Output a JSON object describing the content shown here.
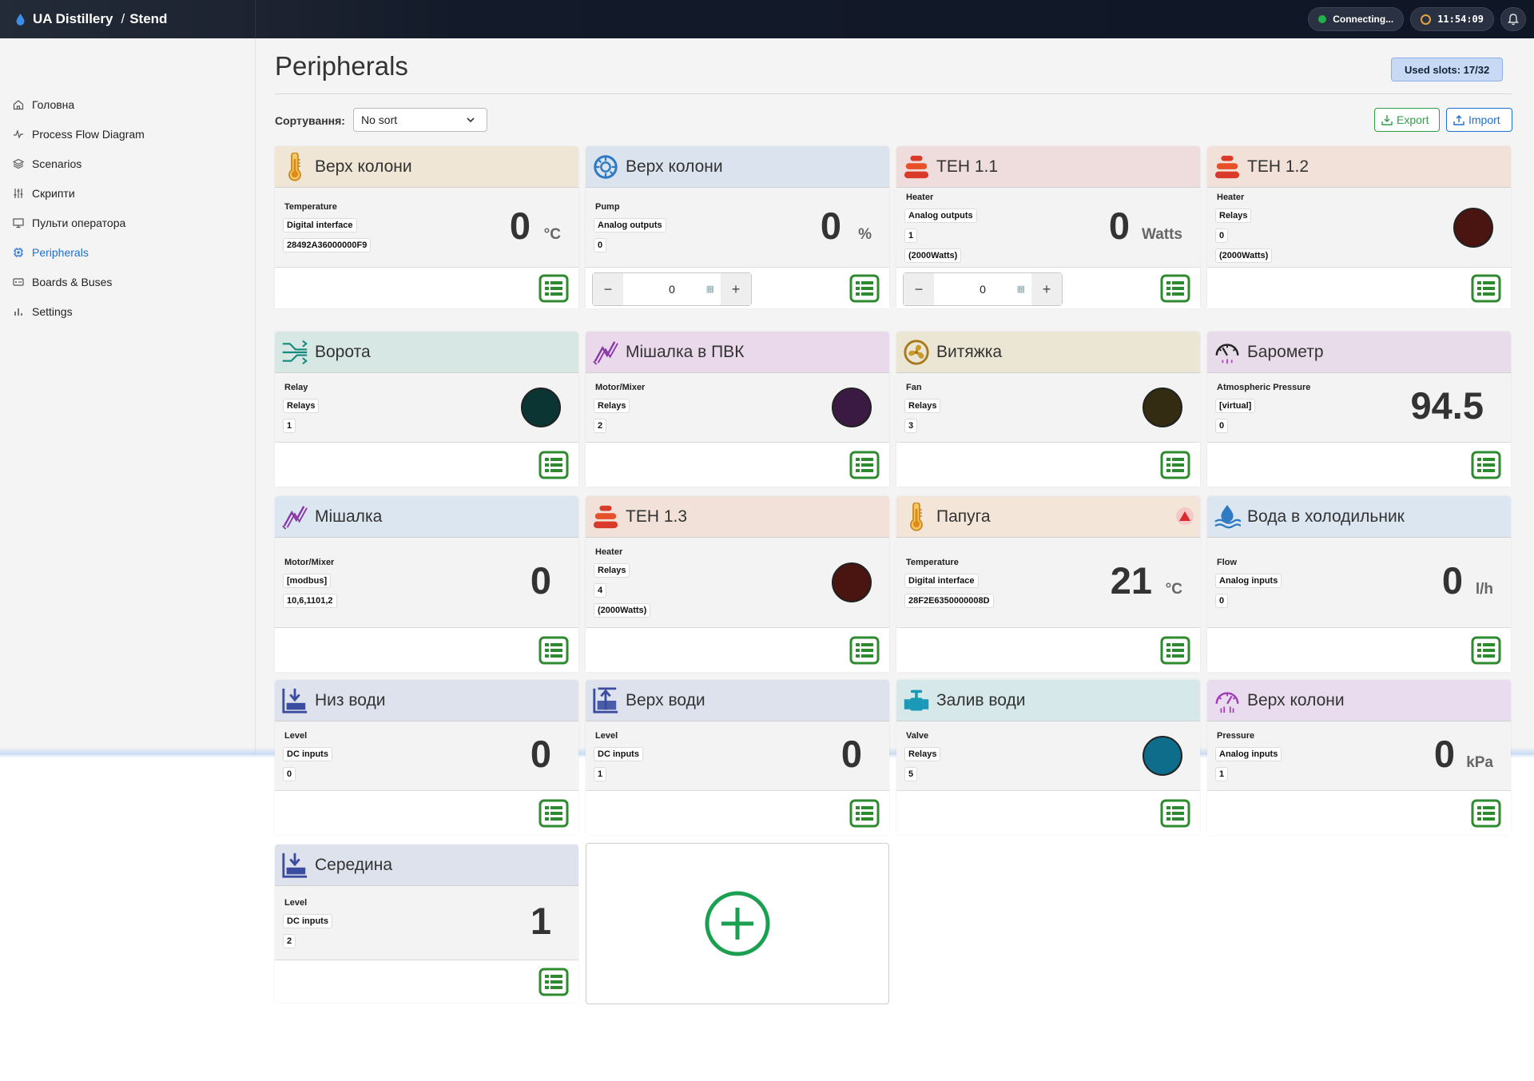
{
  "app": {
    "name": "UA Distillery",
    "separator": "/",
    "location": "Stend"
  },
  "topbar": {
    "status": "Connecting...",
    "time": "11:54:09",
    "status_color": "#22b04a"
  },
  "sidebar": {
    "items": [
      {
        "label": "Головна",
        "icon": "home-icon"
      },
      {
        "label": "Process Flow Diagram",
        "icon": "activity-icon"
      },
      {
        "label": "Scenarios",
        "icon": "layers-icon"
      },
      {
        "label": "Скрипти",
        "icon": "sliders-icon"
      },
      {
        "label": "Пульти оператора",
        "icon": "monitor-icon"
      },
      {
        "label": "Peripherals",
        "icon": "chip-icon",
        "active": true
      },
      {
        "label": "Boards & Buses",
        "icon": "drive-icon"
      },
      {
        "label": "Settings",
        "icon": "bar-chart-icon"
      }
    ]
  },
  "page": {
    "title": "Peripherals",
    "used_slots": "Used slots: 17/32",
    "sort_label": "Сортування:",
    "sort_value": "No sort",
    "export_label": "Export",
    "import_label": "Import"
  },
  "cards": [
    {
      "title": "Верх колони",
      "icon": "thermometer-icon",
      "head_color": "#efe6d6",
      "type": "Temperature",
      "chips": [
        "Digital interface",
        "28492A36000000F9"
      ],
      "value": "0",
      "unit": "°C"
    },
    {
      "title": "Верх колони",
      "icon": "pump-icon",
      "head_color": "#dbe4ee",
      "type": "Pump",
      "chips": [
        "Analog outputs",
        "0"
      ],
      "value": "0",
      "unit": "%",
      "stepper": "0"
    },
    {
      "title": "ТЕН 1.1",
      "icon": "heater-icon",
      "head_color": "#efdcdc",
      "type": "Heater",
      "chips": [
        "Analog outputs",
        "1",
        "(2000Watts)"
      ],
      "value": "0",
      "unit": "Watts",
      "stepper": "0"
    },
    {
      "title": "ТЕН 1.2",
      "icon": "heater-icon",
      "head_color": "#f1e1d9",
      "type": "Heater",
      "chips": [
        "Relays",
        "0",
        "(2000Watts)"
      ],
      "led": "#4a1410"
    },
    {
      "title": "Ворота",
      "icon": "relay-icon",
      "head_color": "#d7e7e4",
      "type": "Relay",
      "chips": [
        "Relays",
        "1"
      ],
      "led": "#0a3532"
    },
    {
      "title": "Мішалка в ПВК",
      "icon": "mixer-icon",
      "head_color": "#ead9ea",
      "type": "Motor/Mixer",
      "chips": [
        "Relays",
        "2"
      ],
      "led": "#3a1a42"
    },
    {
      "title": "Витяжка",
      "icon": "fan-icon",
      "head_color": "#ebe5d3",
      "type": "Fan",
      "chips": [
        "Relays",
        "3"
      ],
      "led": "#332c12"
    },
    {
      "title": "Барометр",
      "icon": "barometer-icon",
      "head_color": "#e8dceb",
      "type": "Atmospheric Pressure",
      "chips": [
        "[virtual]",
        "0"
      ],
      "value": "94.5",
      "unit": ""
    },
    {
      "title": "Мішалка",
      "icon": "mixer-icon",
      "head_color": "#dbe6f1",
      "type": "Motor/Mixer",
      "chips": [
        "[modbus]",
        "10,6,1101,2"
      ],
      "value": "0",
      "unit": ""
    },
    {
      "title": "ТЕН 1.3",
      "icon": "heater-icon",
      "head_color": "#f1e1d9",
      "type": "Heater",
      "chips": [
        "Relays",
        "4",
        "(2000Watts)"
      ],
      "led": "#4a1410"
    },
    {
      "title": "Папуга",
      "icon": "thermometer-icon",
      "head_color": "#f3e5d8",
      "type": "Temperature",
      "chips": [
        "Digital interface",
        "28F2E6350000008D"
      ],
      "value": "21",
      "unit": "°C",
      "warning": true
    },
    {
      "title": "Вода в холодильник",
      "icon": "water-icon",
      "head_color": "#dbe6f1",
      "type": "Flow",
      "chips": [
        "Analog inputs",
        "0"
      ],
      "value": "0",
      "unit": "l/h"
    },
    {
      "title": "Низ води",
      "icon": "level-down-icon",
      "head_color": "#dde2ec",
      "type": "Level",
      "chips": [
        "DC inputs",
        "0"
      ],
      "value": "0",
      "unit": ""
    },
    {
      "title": "Верх води",
      "icon": "level-up-icon",
      "head_color": "#dde2ec",
      "type": "Level",
      "chips": [
        "DC inputs",
        "1"
      ],
      "value": "0",
      "unit": ""
    },
    {
      "title": "Залив води",
      "icon": "valve-icon",
      "head_color": "#d6e8ea",
      "type": "Valve",
      "chips": [
        "Relays",
        "5"
      ],
      "led": "#0e6d8a"
    },
    {
      "title": "Верх колони",
      "icon": "pressure-icon",
      "head_color": "#eadcef",
      "type": "Pressure",
      "chips": [
        "Analog inputs",
        "1"
      ],
      "value": "0",
      "unit": "kPa"
    },
    {
      "title": "Середина",
      "icon": "level-down-icon",
      "head_color": "#dde2ec",
      "type": "Level",
      "chips": [
        "DC inputs",
        "2"
      ],
      "value": "1",
      "unit": ""
    }
  ]
}
